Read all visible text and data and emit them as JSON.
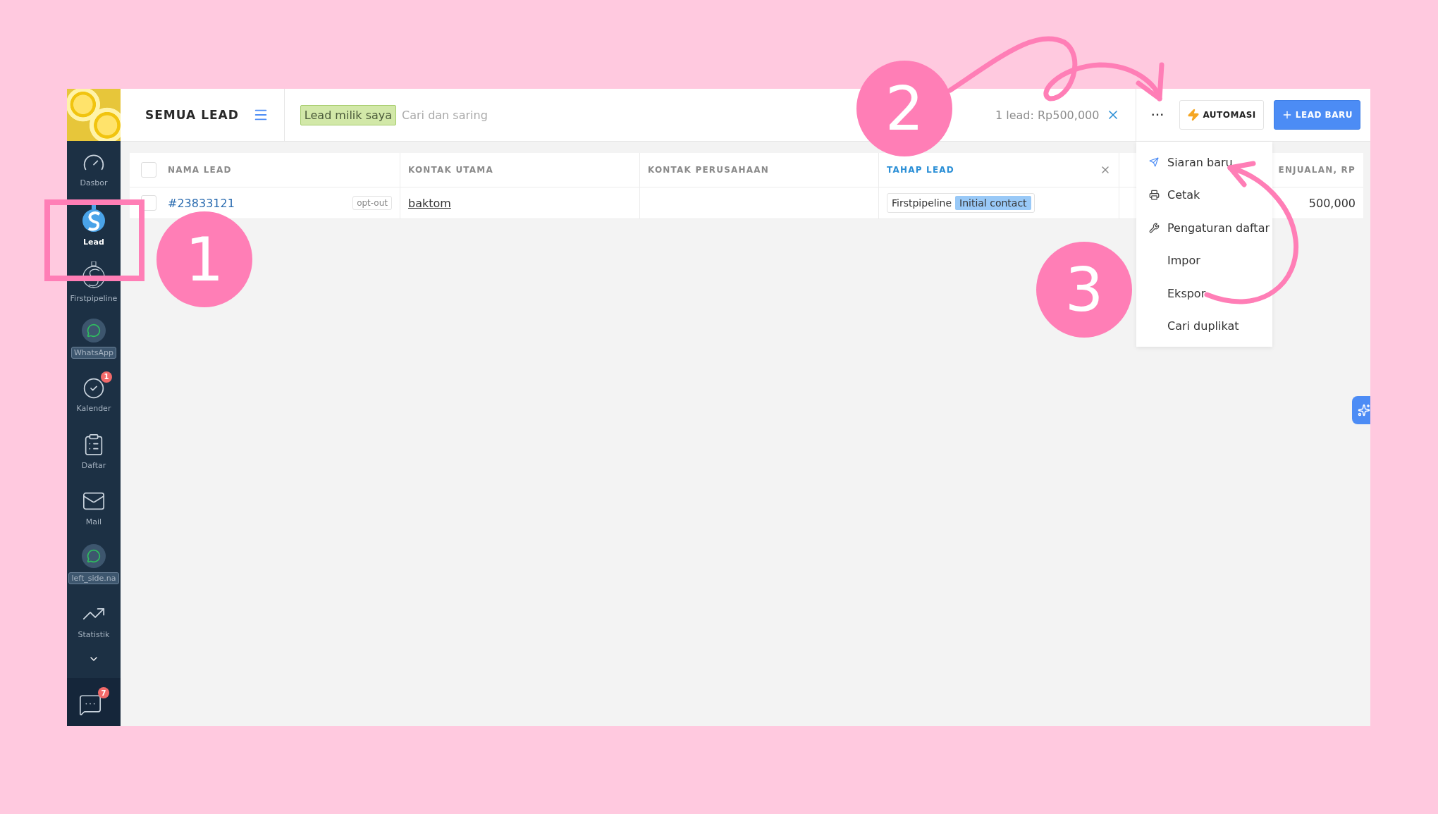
{
  "sidebar": {
    "items": [
      {
        "label": "Dasbor",
        "kind": "gauge",
        "selected": false
      },
      {
        "label": "Lead",
        "kind": "lead",
        "selected": true
      },
      {
        "label": "Firstpipeline",
        "kind": "pipeline",
        "selected": false
      },
      {
        "label": "WhatsApp",
        "kind": "whatsapp",
        "selected": false
      },
      {
        "label": "Kalender",
        "kind": "calendar",
        "selected": false,
        "badge": "1"
      },
      {
        "label": "Daftar",
        "kind": "list",
        "selected": false
      },
      {
        "label": "Mail",
        "kind": "mail",
        "selected": false
      },
      {
        "label": "left_side.na",
        "kind": "whatsapp",
        "selected": false
      },
      {
        "label": "Statistik",
        "kind": "stats",
        "selected": false
      }
    ],
    "chat_badge": "7"
  },
  "header": {
    "title": "SEMUA LEAD",
    "filter_tag": "Lead milik saya",
    "search": {
      "placeholder": "Cari dan saring"
    },
    "summary": "1 lead: Rp500,000",
    "more_label": "···",
    "buttons": [
      {
        "label": "AUTOMASI",
        "kind": "secondary"
      },
      {
        "label": "LEAD BARU",
        "kind": "primary"
      }
    ]
  },
  "table": {
    "select_all": {
      "checked": false
    },
    "columns": [
      {
        "label": "NAMA LEAD",
        "selected": false
      },
      {
        "label": "KONTAK UTAMA",
        "selected": false
      },
      {
        "label": "KONTAK PERUSAHAAN",
        "selected": false
      },
      {
        "label": "TAHAP LEAD",
        "selected": true
      },
      {
        "label": "ENJUALAN, RP",
        "selected": false
      }
    ],
    "rows": [
      {
        "checked": false,
        "name": "#23833121",
        "tag": "opt-out",
        "contact": "baktom",
        "pipeline": "Firstpipeline",
        "stage": "Initial contact",
        "amount": "500,000"
      }
    ]
  },
  "more_menu": {
    "items": [
      {
        "label": "Siaran baru",
        "kind": "broadcast"
      },
      {
        "label": "Cetak",
        "kind": "print"
      },
      {
        "label": "Pengaturan daftar",
        "kind": "settings"
      },
      {
        "label": "Impor",
        "kind": "plain"
      },
      {
        "label": "Ekspor",
        "kind": "plain"
      },
      {
        "label": "Cari duplikat",
        "kind": "plain"
      }
    ]
  },
  "annotations": [
    {
      "label": "1"
    },
    {
      "label": "2"
    },
    {
      "label": "3"
    }
  ]
}
